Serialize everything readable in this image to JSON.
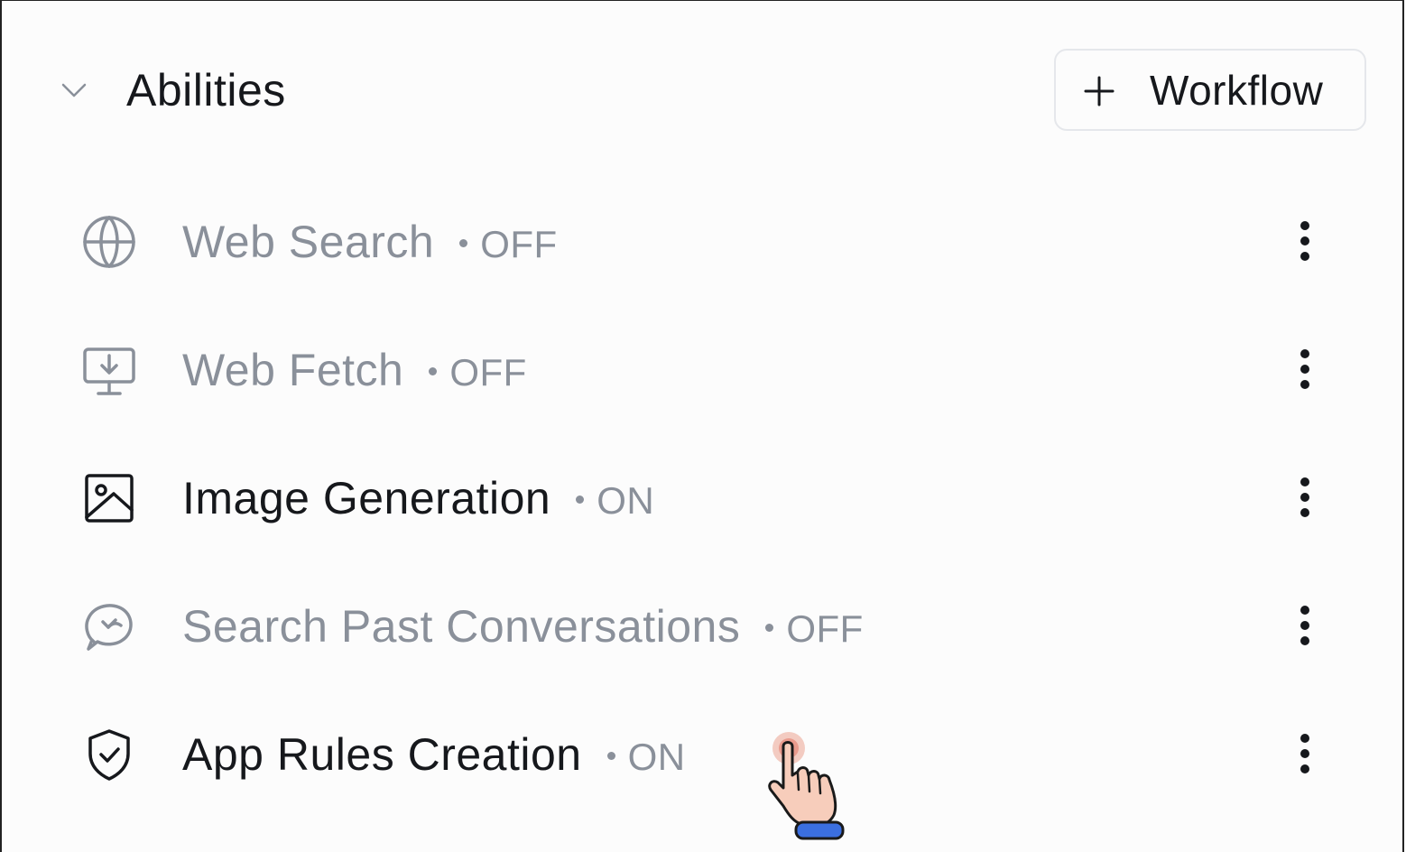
{
  "header": {
    "title": "Abilities",
    "collapse_icon": "chevron-down-icon",
    "add_button_label": "Workflow",
    "add_button_icon": "plus-icon"
  },
  "abilities": [
    {
      "name": "Web Search",
      "status": "OFF",
      "icon": "globe-icon",
      "enabled": false
    },
    {
      "name": "Web Fetch",
      "status": "OFF",
      "icon": "monitor-download-icon",
      "enabled": false
    },
    {
      "name": "Image Generation",
      "status": "ON",
      "icon": "image-icon",
      "enabled": true
    },
    {
      "name": "Search Past Conversations",
      "status": "OFF",
      "icon": "chat-history-icon",
      "enabled": false
    },
    {
      "name": "App Rules Creation",
      "status": "ON",
      "icon": "shield-check-icon",
      "enabled": true
    }
  ],
  "colors": {
    "text_primary": "#16181c",
    "text_muted": "#8a909a",
    "border": "#e5e7eb",
    "background": "#fcfcfc"
  },
  "cursor": "pointer-hand-icon"
}
